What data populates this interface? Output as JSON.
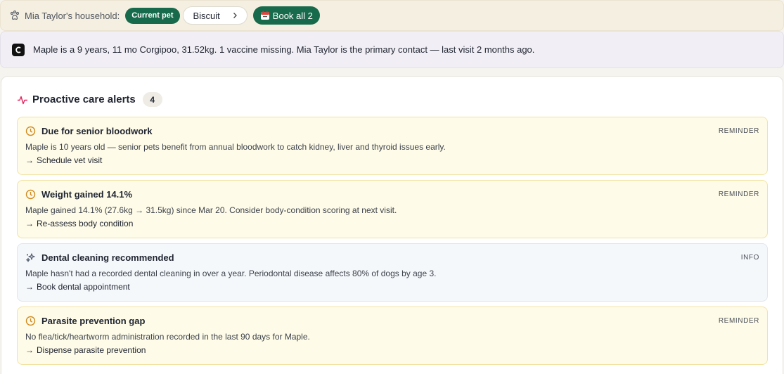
{
  "household": {
    "label": "Mia Taylor's household:",
    "current_pet_label": "Current pet",
    "pet_name": "Biscuit",
    "book_all_label": "Book all 2"
  },
  "summary": {
    "text": "Maple is a 9 years, 11 mo Corgipoo, 31.52kg. 1 vaccine missing. Mia Taylor is the primary contact — last visit 2 months ago."
  },
  "alerts_section": {
    "title": "Proactive care alerts",
    "count": "4",
    "items": [
      {
        "title": "Due for senior bloodwork",
        "tag": "REMINDER",
        "description": "Maple is 10 years old — senior pets benefit from annual bloodwork to catch kidney, liver and thyroid issues early.",
        "action": "Schedule vet visit",
        "icon": "clock-icon"
      },
      {
        "title": "Weight gained 14.1%",
        "tag": "REMINDER",
        "description": "Maple gained 14.1% (27.6kg → 31.5kg) since Mar 20. Consider body-condition scoring at next visit.",
        "action": "Re-assess body condition",
        "icon": "clock-icon"
      },
      {
        "title": "Dental cleaning recommended",
        "tag": "INFO",
        "description": "Maple hasn't had a recorded dental cleaning in over a year. Periodontal disease affects 80% of dogs by age 3.",
        "action": "Book dental appointment",
        "icon": "sparkles-icon"
      },
      {
        "title": "Parasite prevention gap",
        "tag": "REMINDER",
        "description": "No flea/tick/heartworm administration recorded in the last 90 days for Maple.",
        "action": "Dispense parasite prevention",
        "icon": "clock-icon"
      }
    ]
  },
  "colors": {
    "brand_green": "#176a4b",
    "reminder_bg": "#fefbe8",
    "reminder_border": "#f2e3a3",
    "reminder_icon": "#d08a1e",
    "info_bg": "#f5f8fb",
    "pulse_red": "#e0245e"
  }
}
